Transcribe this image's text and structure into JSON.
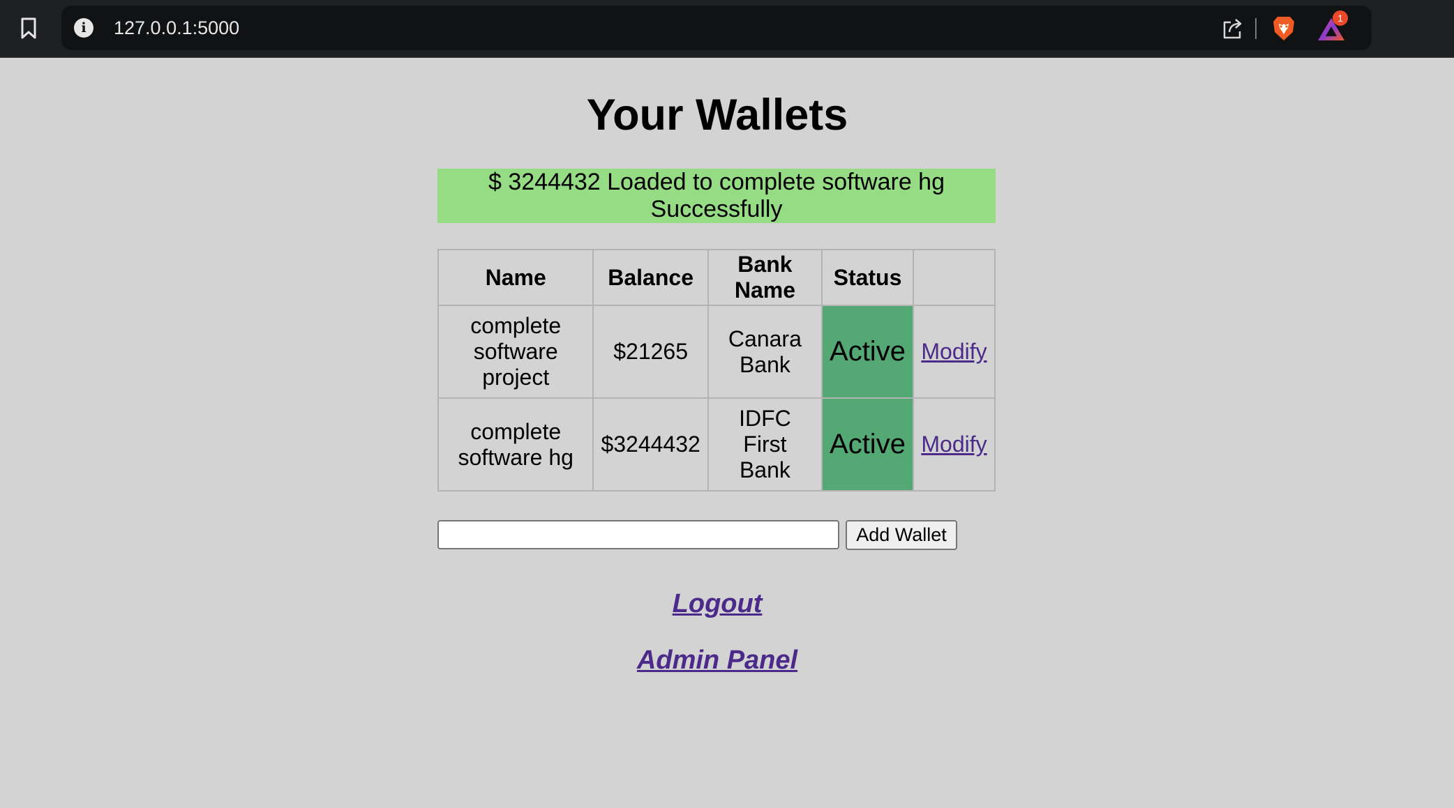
{
  "browser": {
    "url": "127.0.0.1:5000",
    "notification_count": "1",
    "icons": {
      "bookmark": "bookmark-icon",
      "info": "info-icon",
      "share": "share-icon",
      "brave": "brave-shields-icon",
      "rewards": "brave-rewards-icon"
    }
  },
  "page": {
    "title": "Your Wallets",
    "flash_message": "$ 3244432 Loaded to complete software hg Successfully",
    "colors": {
      "flash_background": "#95dc85",
      "status_active_background": "#53a873",
      "link": "#4b2a8a",
      "page_background": "#d3d3d3"
    }
  },
  "table": {
    "headers": {
      "name": "Name",
      "balance": "Balance",
      "bank_name": "Bank Name",
      "status": "Status",
      "action": ""
    },
    "rows": [
      {
        "name": "complete software project",
        "balance": "$21265",
        "bank_name": "Canara Bank",
        "status": "Active",
        "action": "Modify"
      },
      {
        "name": "complete software hg",
        "balance": "$3244432",
        "bank_name": "IDFC First Bank",
        "status": "Active",
        "action": "Modify"
      }
    ]
  },
  "add_wallet": {
    "input_value": "",
    "button_label": "Add Wallet"
  },
  "links": {
    "logout": "Logout",
    "admin_panel": "Admin Panel"
  }
}
